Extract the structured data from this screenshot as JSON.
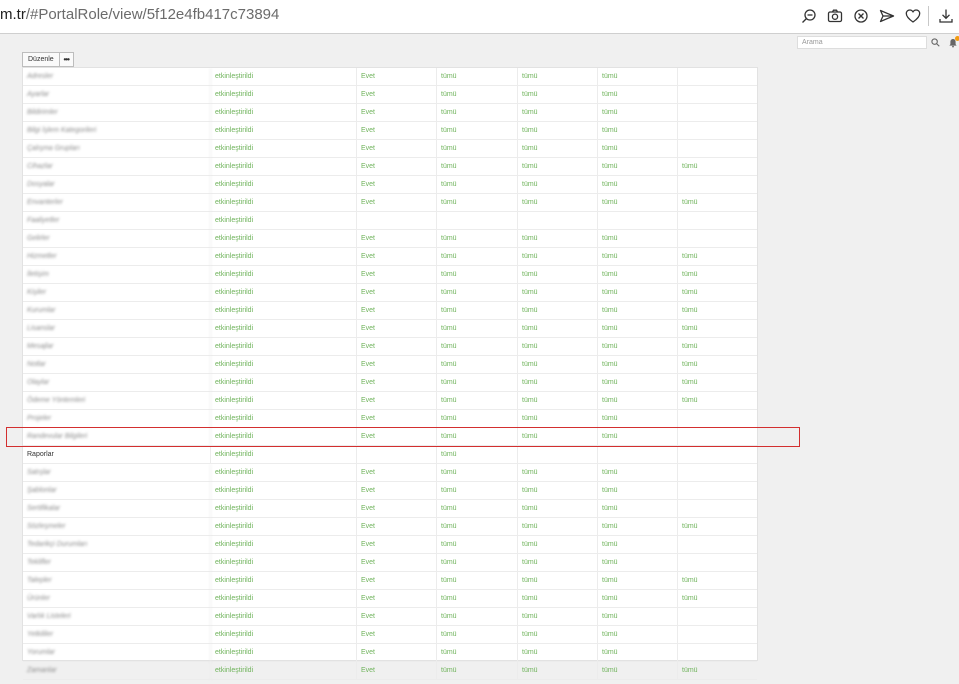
{
  "browser": {
    "url_host": "m.tr",
    "url_path": "/#PortalRole/view/5f12e4fb417c73894",
    "icons": [
      "zoom-out-icon",
      "camera-icon",
      "close-circle-icon",
      "send-icon",
      "heart-icon",
      "download-icon"
    ]
  },
  "toolbar": {
    "edit_label": "Düzenle",
    "more_label": "•••",
    "search_placeholder": "Arama"
  },
  "table": {
    "rows": [
      {
        "name": "Adresler",
        "status": "etkinleştirildi",
        "active": "Evet",
        "c3": "tümü",
        "c4": "tümü",
        "c5": "tümü",
        "c6": ""
      },
      {
        "name": "Ayarlar",
        "status": "etkinleştirildi",
        "active": "Evet",
        "c3": "tümü",
        "c4": "tümü",
        "c5": "tümü",
        "c6": ""
      },
      {
        "name": "Bildirimler",
        "status": "etkinleştirildi",
        "active": "Evet",
        "c3": "tümü",
        "c4": "tümü",
        "c5": "tümü",
        "c6": ""
      },
      {
        "name": "Bilgi İşlem Kategorileri",
        "status": "etkinleştirildi",
        "active": "Evet",
        "c3": "tümü",
        "c4": "tümü",
        "c5": "tümü",
        "c6": ""
      },
      {
        "name": "Çalışma Grupları",
        "status": "etkinleştirildi",
        "active": "Evet",
        "c3": "tümü",
        "c4": "tümü",
        "c5": "tümü",
        "c6": ""
      },
      {
        "name": "Cihazlar",
        "status": "etkinleştirildi",
        "active": "Evet",
        "c3": "tümü",
        "c4": "tümü",
        "c5": "tümü",
        "c6": "tümü"
      },
      {
        "name": "Dosyalar",
        "status": "etkinleştirildi",
        "active": "Evet",
        "c3": "tümü",
        "c4": "tümü",
        "c5": "tümü",
        "c6": ""
      },
      {
        "name": "Envanterler",
        "status": "etkinleştirildi",
        "active": "Evet",
        "c3": "tümü",
        "c4": "tümü",
        "c5": "tümü",
        "c6": "tümü"
      },
      {
        "name": "Faaliyetler",
        "status": "etkinleştirildi",
        "active": "",
        "c3": "",
        "c4": "",
        "c5": "",
        "c6": ""
      },
      {
        "name": "Gelirler",
        "status": "etkinleştirildi",
        "active": "Evet",
        "c3": "tümü",
        "c4": "tümü",
        "c5": "tümü",
        "c6": ""
      },
      {
        "name": "Hizmetler",
        "status": "etkinleştirildi",
        "active": "Evet",
        "c3": "tümü",
        "c4": "tümü",
        "c5": "tümü",
        "c6": "tümü"
      },
      {
        "name": "İletişim",
        "status": "etkinleştirildi",
        "active": "Evet",
        "c3": "tümü",
        "c4": "tümü",
        "c5": "tümü",
        "c6": "tümü"
      },
      {
        "name": "Kişiler",
        "status": "etkinleştirildi",
        "active": "Evet",
        "c3": "tümü",
        "c4": "tümü",
        "c5": "tümü",
        "c6": "tümü"
      },
      {
        "name": "Kurumlar",
        "status": "etkinleştirildi",
        "active": "Evet",
        "c3": "tümü",
        "c4": "tümü",
        "c5": "tümü",
        "c6": "tümü"
      },
      {
        "name": "Lisanslar",
        "status": "etkinleştirildi",
        "active": "Evet",
        "c3": "tümü",
        "c4": "tümü",
        "c5": "tümü",
        "c6": "tümü"
      },
      {
        "name": "Mesajlar",
        "status": "etkinleştirildi",
        "active": "Evet",
        "c3": "tümü",
        "c4": "tümü",
        "c5": "tümü",
        "c6": "tümü"
      },
      {
        "name": "Notlar",
        "status": "etkinleştirildi",
        "active": "Evet",
        "c3": "tümü",
        "c4": "tümü",
        "c5": "tümü",
        "c6": "tümü"
      },
      {
        "name": "Olaylar",
        "status": "etkinleştirildi",
        "active": "Evet",
        "c3": "tümü",
        "c4": "tümü",
        "c5": "tümü",
        "c6": "tümü"
      },
      {
        "name": "Ödeme Yöntemleri",
        "status": "etkinleştirildi",
        "active": "Evet",
        "c3": "tümü",
        "c4": "tümü",
        "c5": "tümü",
        "c6": "tümü"
      },
      {
        "name": "Projeler",
        "status": "etkinleştirildi",
        "active": "Evet",
        "c3": "tümü",
        "c4": "tümü",
        "c5": "tümü",
        "c6": ""
      },
      {
        "name": "Randevular Bilgileri",
        "status": "etkinleştirildi",
        "active": "Evet",
        "c3": "tümü",
        "c4": "tümü",
        "c5": "tümü",
        "c6": ""
      },
      {
        "name": "Raporlar",
        "status": "etkinleştirildi",
        "active": "",
        "c3": "tümü",
        "c4": "",
        "c5": "",
        "c6": "",
        "clear": true
      },
      {
        "name": "Satışlar",
        "status": "etkinleştirildi",
        "active": "Evet",
        "c3": "tümü",
        "c4": "tümü",
        "c5": "tümü",
        "c6": ""
      },
      {
        "name": "Şablonlar",
        "status": "etkinleştirildi",
        "active": "Evet",
        "c3": "tümü",
        "c4": "tümü",
        "c5": "tümü",
        "c6": ""
      },
      {
        "name": "Sertifikalar",
        "status": "etkinleştirildi",
        "active": "Evet",
        "c3": "tümü",
        "c4": "tümü",
        "c5": "tümü",
        "c6": ""
      },
      {
        "name": "Sözleşmeler",
        "status": "etkinleştirildi",
        "active": "Evet",
        "c3": "tümü",
        "c4": "tümü",
        "c5": "tümü",
        "c6": "tümü"
      },
      {
        "name": "Tedarikçi Durumları",
        "status": "etkinleştirildi",
        "active": "Evet",
        "c3": "tümü",
        "c4": "tümü",
        "c5": "tümü",
        "c6": ""
      },
      {
        "name": "Teklifler",
        "status": "etkinleştirildi",
        "active": "Evet",
        "c3": "tümü",
        "c4": "tümü",
        "c5": "tümü",
        "c6": ""
      },
      {
        "name": "Talepler",
        "status": "etkinleştirildi",
        "active": "Evet",
        "c3": "tümü",
        "c4": "tümü",
        "c5": "tümü",
        "c6": "tümü"
      },
      {
        "name": "Ürünler",
        "status": "etkinleştirildi",
        "active": "Evet",
        "c3": "tümü",
        "c4": "tümü",
        "c5": "tümü",
        "c6": "tümü"
      },
      {
        "name": "Varlık Listeleri",
        "status": "etkinleştirildi",
        "active": "Evet",
        "c3": "tümü",
        "c4": "tümü",
        "c5": "tümü",
        "c6": ""
      },
      {
        "name": "Yetkililer",
        "status": "etkinleştirildi",
        "active": "Evet",
        "c3": "tümü",
        "c4": "tümü",
        "c5": "tümü",
        "c6": ""
      },
      {
        "name": "Yorumlar",
        "status": "etkinleştirildi",
        "active": "Evet",
        "c3": "tümü",
        "c4": "tümü",
        "c5": "tümü",
        "c6": ""
      },
      {
        "name": "Zamanlar",
        "status": "etkinleştirildi",
        "active": "Evet",
        "c3": "tümü",
        "c4": "tümü",
        "c5": "tümü",
        "c6": "tümü"
      }
    ]
  },
  "colors": {
    "value_green": "#6fb35b",
    "highlight_red": "#d32f2f"
  }
}
